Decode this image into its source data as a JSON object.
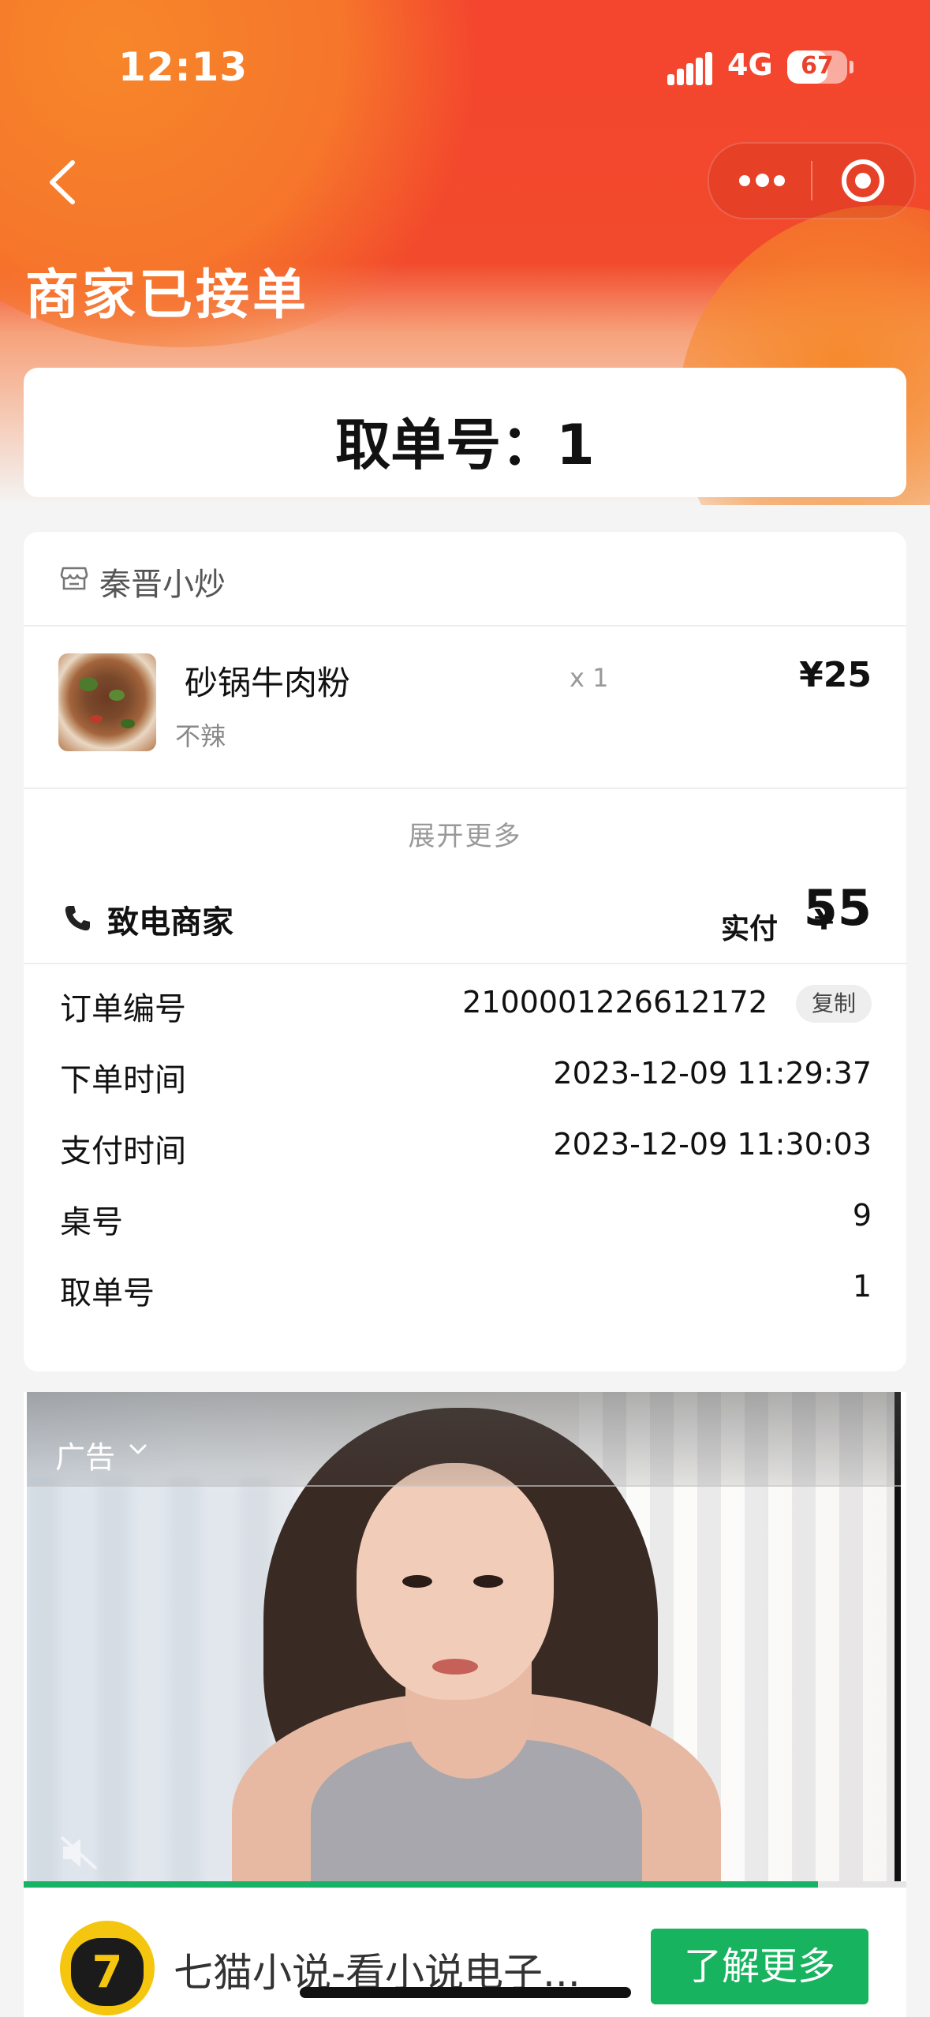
{
  "status_bar": {
    "time": "12:13",
    "network": "4G",
    "battery_level": "67",
    "battery_fraction": 0.67
  },
  "nav": {
    "back_icon": "chevron-left-icon",
    "menu_icon": "more-dots-icon",
    "close_icon": "target-circle-icon"
  },
  "page": {
    "title": "商家已接单",
    "pickup_text": "取单号：1"
  },
  "colors": {
    "header_red": "#f4452e",
    "header_orange": "#f7862a",
    "ad_green": "#17b35f"
  },
  "order": {
    "shop_icon": "store-icon",
    "shop_name": "秦晋小炒",
    "item": {
      "name": "砂锅牛肉粉",
      "spec": "不辣",
      "qty": "x 1",
      "price": "¥25"
    },
    "expand_label": "展开更多",
    "call_label": "致电商家",
    "call_icon": "phone-icon",
    "paid_label": "实付",
    "paid_currency": "¥",
    "paid_amount": "55"
  },
  "info": [
    {
      "label": "订单编号",
      "value": "2100001226612172"
    },
    {
      "label": "下单时间",
      "value": "2023-12-09 11:29:37"
    },
    {
      "label": "支付时间",
      "value": "2023-12-09 11:30:03"
    },
    {
      "label": "桌号",
      "value": "9"
    },
    {
      "label": "取单号",
      "value": "1"
    }
  ],
  "copy_label": "复制",
  "ad": {
    "label": "广告",
    "chevron_icon": "chevron-down-icon",
    "mute_icon": "mute-icon",
    "progress_fraction": 0.9,
    "app_logo_text": "7",
    "title": "七猫小说-看小说电子...",
    "button_label": "了解更多"
  }
}
